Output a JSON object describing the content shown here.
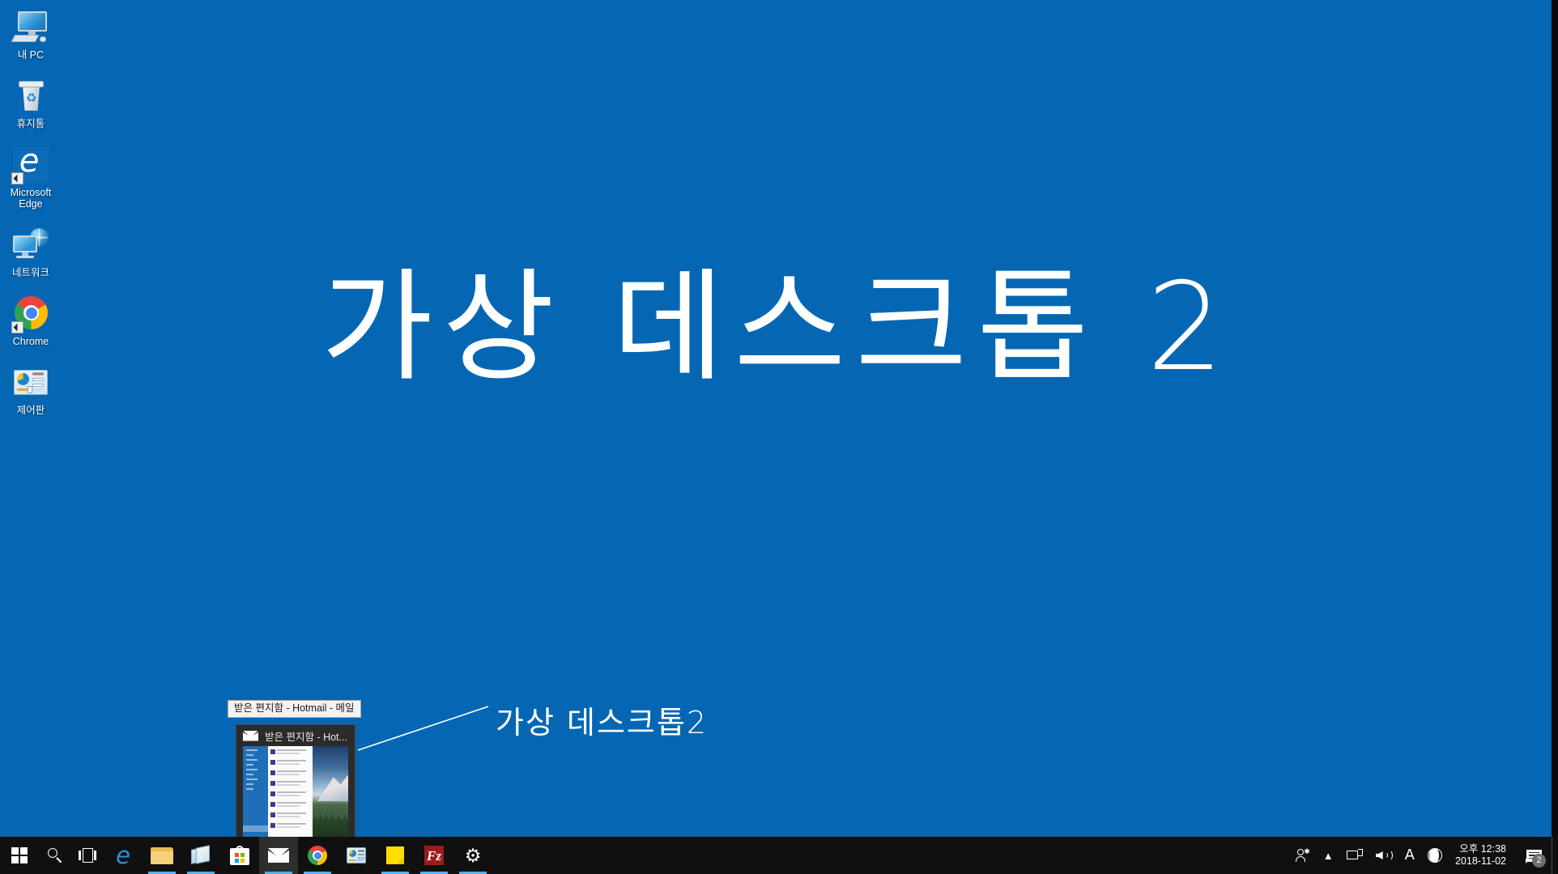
{
  "desktop": {
    "background_color": "#0567b4",
    "title": "가상 데스크톱 2",
    "icons": [
      {
        "label": "내 PC",
        "icon": "computer-icon"
      },
      {
        "label": "휴지통",
        "icon": "recycle-bin-icon"
      },
      {
        "label": "Microsoft Edge",
        "icon": "edge-icon"
      },
      {
        "label": "네트워크",
        "icon": "network-icon"
      },
      {
        "label": "Chrome",
        "icon": "chrome-icon"
      },
      {
        "label": "제어판",
        "icon": "control-panel-icon"
      }
    ]
  },
  "annotation": {
    "label": "가상 데스크톱2",
    "line_color": "#ffffff"
  },
  "thumbnail_preview": {
    "tooltip": "받은 편지함 - Hotmail - 메일",
    "title": "받은 편지함 - Hot...",
    "icon": "mail-icon"
  },
  "taskbar": {
    "background_color": "#101010",
    "accent_color": "#4cb2f0",
    "items": [
      {
        "name": "start-button",
        "icon": "windows-logo-icon",
        "active": false,
        "running": false
      },
      {
        "name": "search-button",
        "icon": "search-icon",
        "active": false,
        "running": false
      },
      {
        "name": "task-view-button",
        "icon": "task-view-icon",
        "active": false,
        "running": false
      },
      {
        "name": "taskbar-app-edge",
        "icon": "edge-icon",
        "active": false,
        "running": false
      },
      {
        "name": "taskbar-app-explorer",
        "icon": "file-explorer-icon",
        "active": false,
        "running": true
      },
      {
        "name": "taskbar-app-reader",
        "icon": "reader-icon",
        "active": false,
        "running": true
      },
      {
        "name": "taskbar-app-store",
        "icon": "microsoft-store-icon",
        "active": false,
        "running": false
      },
      {
        "name": "taskbar-app-mail",
        "icon": "mail-icon",
        "active": true,
        "running": true
      },
      {
        "name": "taskbar-app-chrome",
        "icon": "chrome-icon",
        "active": false,
        "running": true
      },
      {
        "name": "taskbar-app-control-panel",
        "icon": "control-panel-icon",
        "active": false,
        "running": false
      },
      {
        "name": "taskbar-app-sticky-notes",
        "icon": "sticky-note-icon",
        "active": false,
        "running": true
      },
      {
        "name": "taskbar-app-filezilla",
        "icon": "filezilla-icon",
        "active": false,
        "running": true,
        "letters": "Fz"
      },
      {
        "name": "taskbar-app-settings",
        "icon": "gear-icon",
        "active": false,
        "running": true
      }
    ]
  },
  "tray": {
    "items": [
      {
        "name": "people-icon",
        "icon": "people-icon"
      },
      {
        "name": "show-hidden-icons",
        "icon": "chevron-up-icon"
      },
      {
        "name": "network-icon",
        "icon": "network-icon"
      },
      {
        "name": "volume-icon",
        "icon": "speaker-icon"
      },
      {
        "name": "ime-indicator",
        "icon": "ime-icon",
        "glyph": "A"
      },
      {
        "name": "night-light-icon",
        "icon": "moon-icon"
      }
    ],
    "clock": {
      "time": "오후 12:38",
      "date": "2018-11-02"
    },
    "notifications": {
      "icon": "notification-center-icon",
      "count": "2"
    }
  }
}
